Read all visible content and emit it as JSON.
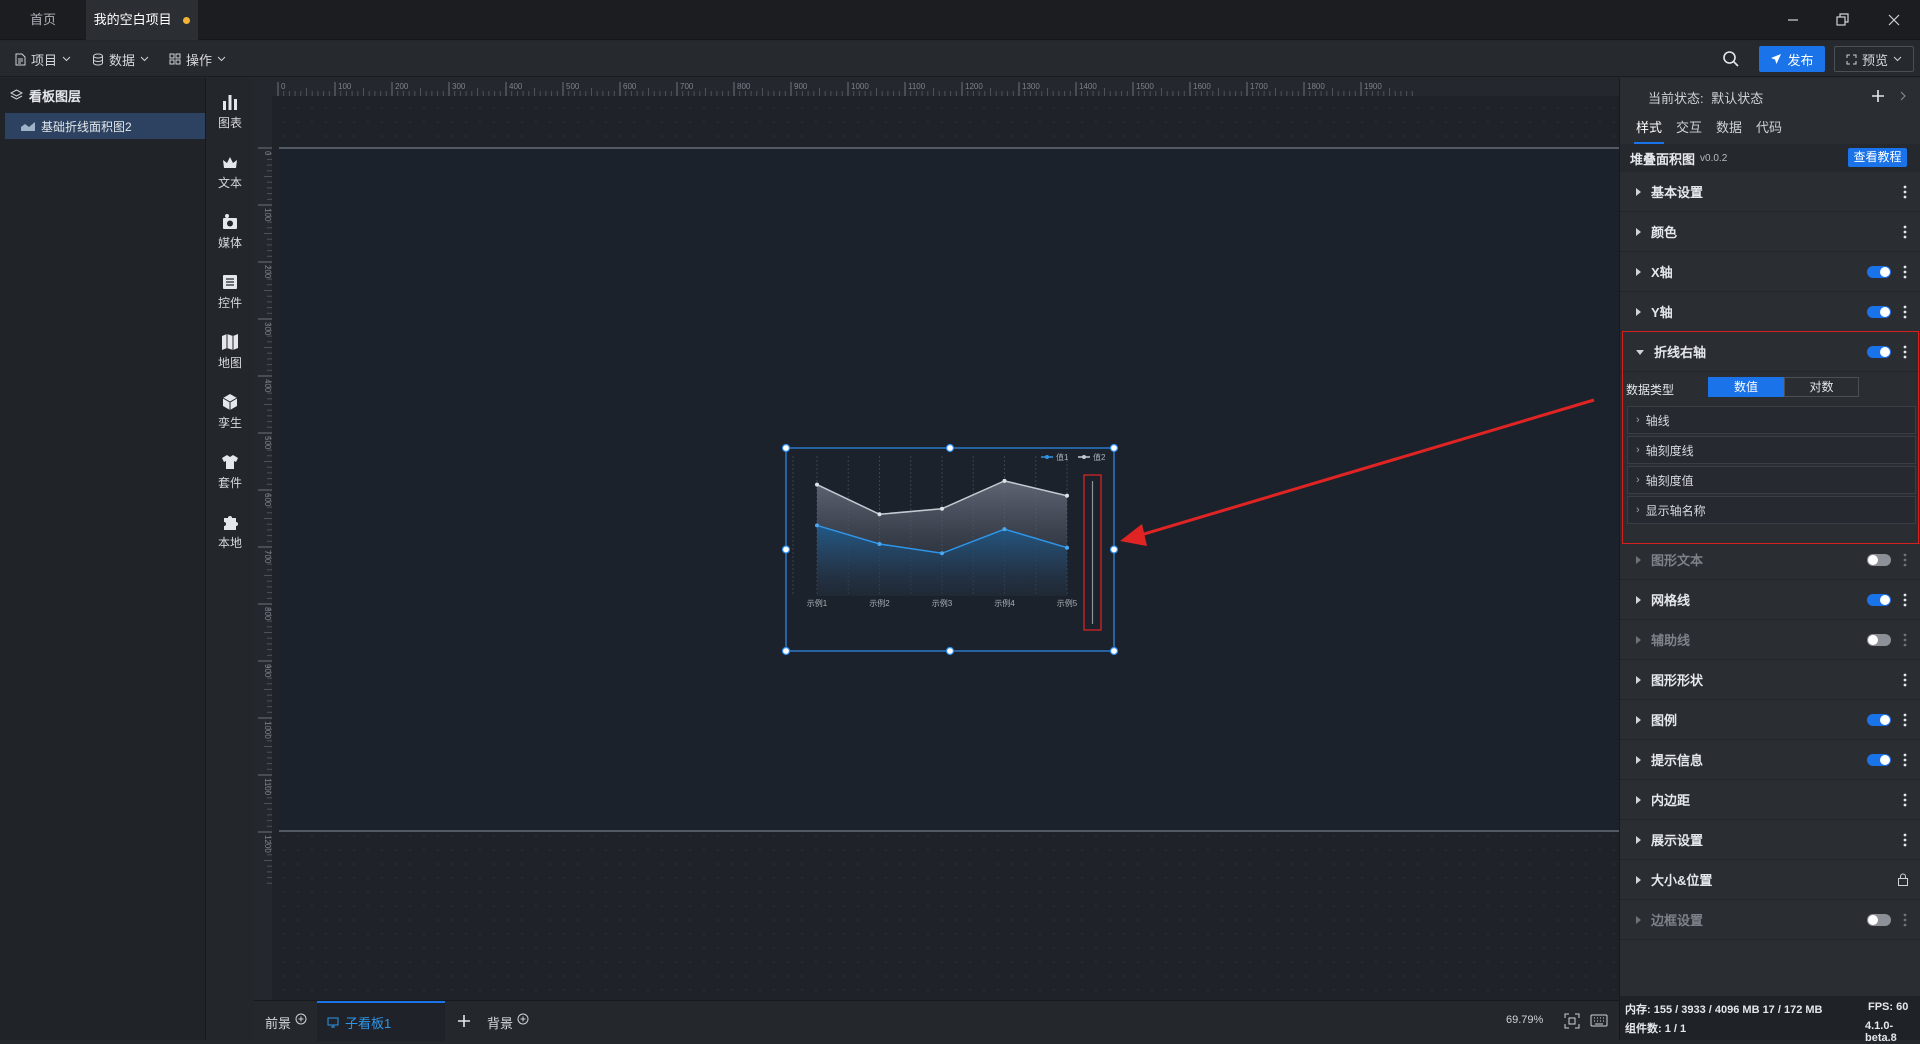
{
  "titlebar": {
    "tabs": [
      {
        "label": "首页"
      },
      {
        "label": "我的空白项目"
      }
    ]
  },
  "toolbar": {
    "menus": [
      {
        "label": "项目"
      },
      {
        "label": "数据"
      },
      {
        "label": "操作"
      }
    ],
    "publish_label": "发布",
    "preview_label": "预览"
  },
  "layers": {
    "title": "看板图层",
    "items": [
      {
        "label": "基础折线面积图2"
      }
    ]
  },
  "tools": [
    {
      "label": "图表",
      "icon": "bar-chart-icon"
    },
    {
      "label": "文本",
      "icon": "text-icon"
    },
    {
      "label": "媒体",
      "icon": "media-icon"
    },
    {
      "label": "控件",
      "icon": "widget-icon"
    },
    {
      "label": "地图",
      "icon": "map-icon"
    },
    {
      "label": "孪生",
      "icon": "cube-icon"
    },
    {
      "label": "套件",
      "icon": "shirt-icon"
    },
    {
      "label": "本地",
      "icon": "puzzle-icon"
    }
  ],
  "ruler": {
    "h_labels": [
      "0",
      "100",
      "200",
      "300",
      "400",
      "500",
      "600",
      "700",
      "800",
      "900",
      "1000",
      "1100",
      "1200",
      "1300",
      "1400",
      "1500",
      "1600",
      "1700",
      "1800",
      "1900"
    ],
    "v_labels": [
      "0",
      "100",
      "200",
      "300",
      "400",
      "500",
      "600",
      "700",
      "800",
      "900",
      "1000",
      "1100",
      "1200"
    ]
  },
  "chart": {
    "legend": [
      {
        "name": "值1",
        "color": "#2f95e8"
      },
      {
        "name": "值2",
        "color": "#bfc4cc"
      }
    ],
    "chart_data": {
      "type": "area",
      "categories": [
        "示例1",
        "示例2",
        "示例3",
        "示例4",
        "示例5"
      ],
      "series": [
        {
          "name": "值1",
          "values": [
            38,
            28,
            23,
            36,
            26
          ]
        },
        {
          "name": "值2",
          "values": [
            60,
            44,
            47,
            62,
            54
          ]
        }
      ],
      "ylim": [
        0,
        70
      ],
      "stacked": false,
      "grid": "vertical-dashed",
      "legend_position": "top-right"
    }
  },
  "bottombar": {
    "tabs": [
      {
        "label": "前景"
      },
      {
        "label": "子看板1"
      },
      {
        "label": "背景"
      }
    ],
    "zoom": "69.79%"
  },
  "rpanel": {
    "state_label": "当前状态:",
    "state_value": "默认状态",
    "tabs": [
      {
        "label": "样式"
      },
      {
        "label": "交互"
      },
      {
        "label": "数据"
      },
      {
        "label": "代码"
      }
    ],
    "component_name": "堆叠面积图",
    "version": "v0.0.2",
    "tutorial_label": "查看教程",
    "sections": [
      {
        "label": "基本设置"
      },
      {
        "label": "颜色"
      },
      {
        "label": "X轴"
      },
      {
        "label": "Y轴"
      },
      {
        "label": "折线右轴"
      },
      {
        "label": "图形文本"
      },
      {
        "label": "网格线"
      },
      {
        "label": "辅助线"
      },
      {
        "label": "图形形状"
      },
      {
        "label": "图例"
      },
      {
        "label": "提示信息"
      },
      {
        "label": "内边距"
      },
      {
        "label": "展示设置"
      },
      {
        "label": "大小&位置"
      },
      {
        "label": "边框设置"
      }
    ],
    "data_type_label": "数据类型",
    "data_type_options": [
      {
        "label": "数值"
      },
      {
        "label": "对数"
      }
    ],
    "subsections": [
      {
        "label": "轴线"
      },
      {
        "label": "轴刻度线"
      },
      {
        "label": "轴刻度值"
      },
      {
        "label": "显示轴名称"
      }
    ],
    "status": {
      "memory": "内存: 155 / 3933 / 4096 MB  17 / 172 MB",
      "fps": "FPS:  60",
      "components": "组件数: 1 / 1",
      "build": "4.1.0-beta.8"
    }
  },
  "colors": {
    "accent": "#1a73e8",
    "highlight_red": "#e02424"
  }
}
